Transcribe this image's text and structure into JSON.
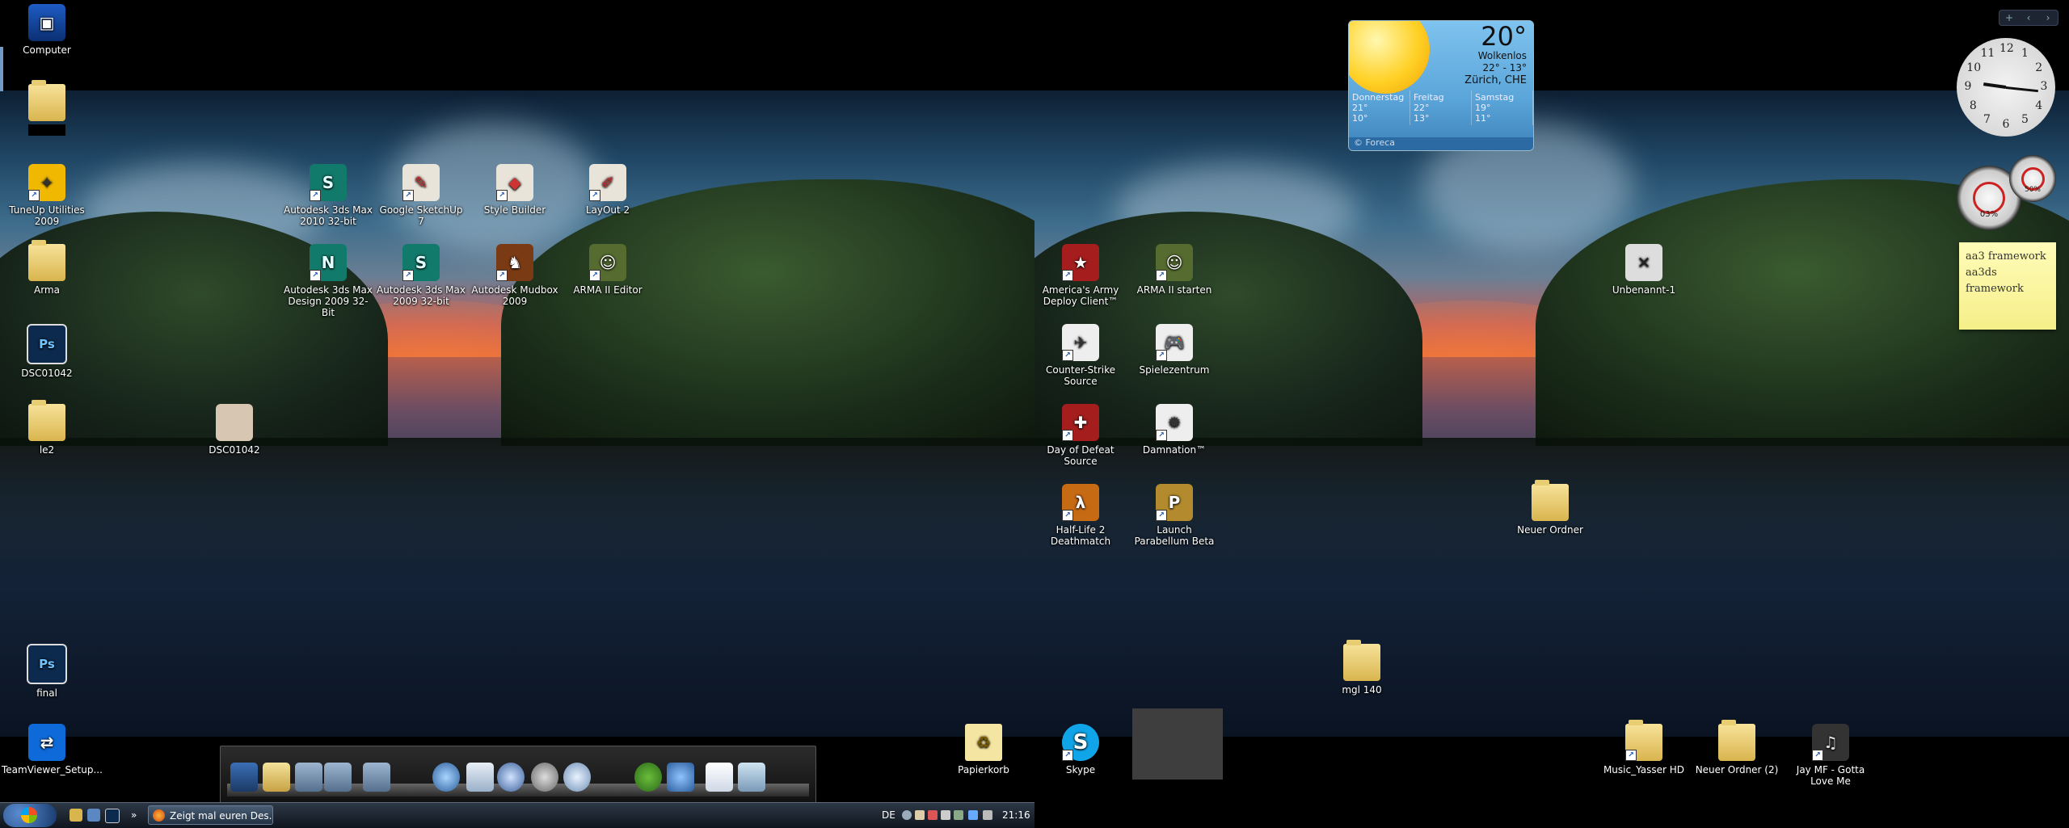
{
  "desktop_left": {
    "icons": [
      {
        "id": "computer",
        "label": "Computer",
        "kind": "computer",
        "glyph": "▣",
        "shortcut": false
      },
      {
        "id": "hidden-folder",
        "label": "",
        "kind": "folder",
        "glyph": "",
        "shortcut": false
      },
      {
        "id": "tuneup",
        "label": "TuneUp Utilities 2009",
        "kind": "tune",
        "glyph": "✦",
        "shortcut": true
      },
      {
        "id": "arma-folder",
        "label": "Arma",
        "kind": "folder",
        "glyph": "",
        "shortcut": false
      },
      {
        "id": "dsc-ps",
        "label": "DSC01042",
        "kind": "ps",
        "glyph": "Ps",
        "shortcut": false
      },
      {
        "id": "le2",
        "label": "le2",
        "kind": "folder",
        "glyph": "",
        "shortcut": false
      },
      {
        "id": "final",
        "label": "final",
        "kind": "ps",
        "glyph": "Ps",
        "shortcut": false
      },
      {
        "id": "teamviewer",
        "label": "TeamViewer_Setup...",
        "kind": "team",
        "glyph": "⇄",
        "shortcut": false
      },
      {
        "id": "dsc-photo",
        "label": "DSC01042",
        "kind": "photo",
        "glyph": "",
        "shortcut": false
      },
      {
        "id": "max2010",
        "label": "Autodesk 3ds Max 2010 32-bit",
        "kind": "max",
        "glyph": "S",
        "shortcut": true
      },
      {
        "id": "sketchup",
        "label": "Google SketchUp 7",
        "kind": "sketch",
        "glyph": "✎",
        "shortcut": true
      },
      {
        "id": "stylebuilder",
        "label": "Style Builder",
        "kind": "sketch",
        "glyph": "◆",
        "shortcut": true
      },
      {
        "id": "layout2",
        "label": "LayOut 2",
        "kind": "sketch",
        "glyph": "✐",
        "shortcut": true
      },
      {
        "id": "maxdesign",
        "label": "Autodesk 3ds Max Design 2009 32-Bit",
        "kind": "max",
        "glyph": "N",
        "shortcut": true
      },
      {
        "id": "max2009",
        "label": "Autodesk 3ds Max 2009 32-bit",
        "kind": "max",
        "glyph": "S",
        "shortcut": true
      },
      {
        "id": "mudbox",
        "label": "Autodesk Mudbox 2009",
        "kind": "mud",
        "glyph": "♞",
        "shortcut": true
      },
      {
        "id": "armaeditor",
        "label": "ARMA II Editor",
        "kind": "arma",
        "glyph": "☺",
        "shortcut": true
      },
      {
        "id": "papierkorb",
        "label": "Papierkorb",
        "kind": "trash",
        "glyph": "♻",
        "shortcut": false
      }
    ]
  },
  "desktop_right": {
    "icons": [
      {
        "id": "americas-army",
        "label": "America's Army Deploy Client™",
        "kind": "red",
        "glyph": "★",
        "shortcut": true
      },
      {
        "id": "arma2",
        "label": "ARMA II starten",
        "kind": "arma",
        "glyph": "☺",
        "shortcut": true
      },
      {
        "id": "cs-source",
        "label": "Counter-Strike Source",
        "kind": "cs",
        "glyph": "✈",
        "shortcut": true
      },
      {
        "id": "spielezentrum",
        "label": "Spielezentrum",
        "kind": "cs",
        "glyph": "🎮",
        "shortcut": true
      },
      {
        "id": "dod-source",
        "label": "Day of Defeat Source",
        "kind": "red",
        "glyph": "✚",
        "shortcut": true
      },
      {
        "id": "damnation",
        "label": "Damnation™",
        "kind": "cs",
        "glyph": "✹",
        "shortcut": true
      },
      {
        "id": "hl2dm",
        "label": "Half-Life 2 Deathmatch",
        "kind": "orange",
        "glyph": "λ",
        "shortcut": true
      },
      {
        "id": "parabellum",
        "label": "Launch Parabellum Beta",
        "kind": "gold",
        "glyph": "P",
        "shortcut": true
      },
      {
        "id": "unbenannt",
        "label": "Unbenannt-1",
        "kind": "blank",
        "glyph": "✕",
        "shortcut": false
      },
      {
        "id": "neuer-ordner",
        "label": "Neuer Ordner",
        "kind": "folder",
        "glyph": "",
        "shortcut": false
      },
      {
        "id": "mgl140",
        "label": "mgl 140",
        "kind": "folder",
        "glyph": "",
        "shortcut": false
      },
      {
        "id": "skype",
        "label": "Skype",
        "kind": "skype",
        "glyph": "S",
        "shortcut": true
      },
      {
        "id": "music-yasser",
        "label": "Music_Yasser HD",
        "kind": "folder",
        "glyph": "",
        "shortcut": true
      },
      {
        "id": "neuer-ordner-2",
        "label": "Neuer Ordner (2)",
        "kind": "folder",
        "glyph": "",
        "shortcut": false
      },
      {
        "id": "jay-mf",
        "label": "Jay MF - Gotta Love Me",
        "kind": "music",
        "glyph": "♫",
        "shortcut": true
      }
    ]
  },
  "weather": {
    "temperature": "20°",
    "condition": "Wolkenlos",
    "range": "22° - 13°",
    "location": "Zürich, CHE",
    "forecast": [
      {
        "day": "Donnerstag",
        "high": "21°",
        "low": "10°"
      },
      {
        "day": "Freitag",
        "high": "22°",
        "low": "13°"
      },
      {
        "day": "Samstag",
        "high": "19°",
        "low": "11°"
      }
    ],
    "credit": "© Foreca"
  },
  "clock": {
    "numbers": [
      "12",
      "1",
      "2",
      "3",
      "4",
      "5",
      "6",
      "7",
      "8",
      "9",
      "10",
      "11"
    ],
    "time": "21:16"
  },
  "meters": [
    {
      "name": "cpu-meter",
      "percent": "03%"
    },
    {
      "name": "ram-meter",
      "percent": "50%"
    }
  ],
  "sticky_note": {
    "lines": [
      "aa3 framework",
      "aa3ds",
      "framework"
    ]
  },
  "gadget_controls": [
    "+",
    "‹",
    "›"
  ],
  "taskbar": {
    "task_label": "Zeigt mal euren Des...",
    "language": "DE",
    "clock": "21:16",
    "overflow": "»"
  },
  "colors": {
    "taskbar_top": "#2d3846",
    "taskbar_bottom": "#0f151e",
    "sticky_note": "#fffcb8"
  }
}
